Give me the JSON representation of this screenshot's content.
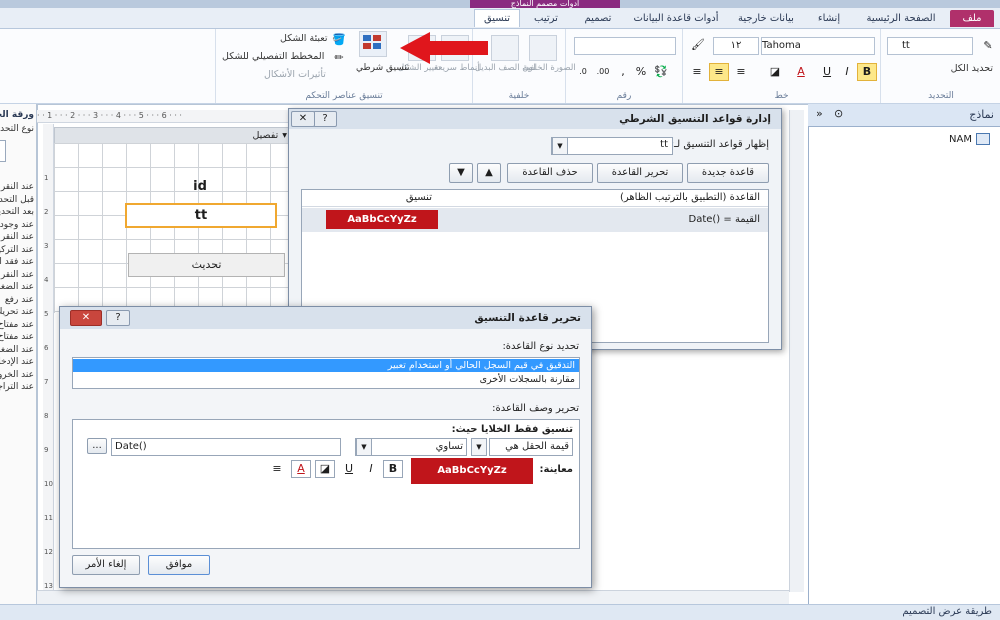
{
  "window": {
    "context_header": "أدوات مصمم النماذج"
  },
  "tabs": [
    {
      "label": "ملف",
      "kind": "file"
    },
    {
      "label": "الصفحة الرئيسية"
    },
    {
      "label": "إنشاء"
    },
    {
      "label": "بيانات خارجية"
    },
    {
      "label": "أدوات قاعدة البيانات"
    },
    {
      "label": "تصميم"
    },
    {
      "label": "ترتيب"
    },
    {
      "label": "تنسيق",
      "active": true
    }
  ],
  "ribbon": {
    "selection_group": {
      "label": "التحديد",
      "combo": "tt",
      "select_all": "تحديد الكل"
    },
    "font_group": {
      "label": "خط",
      "font_name": "Tahoma",
      "font_size": "١٢"
    },
    "number_group": {
      "label": "رقم"
    },
    "background_group": {
      "label": "خلفية",
      "image_label": "الصورة الخلفية",
      "alt_color_label": "لون الصف البديل"
    },
    "control_format_group": {
      "label": "تنسيق عناصر التحكم",
      "quick_styles": "أنماط سريعة",
      "change_shape": "تغيير الشكل",
      "conditional_formatting": "تنسيق شرطي",
      "shape_fill": "تعبئة الشكل",
      "shape_outline": "المخطط التفصيلي للشكل",
      "shape_effects": "تأثيرات الأشكال"
    }
  },
  "left_panel": {
    "title": "ورقة الخصائص",
    "subtitle": "نوع التحديد",
    "events": [
      "عند النقر",
      "قبل التحديث",
      "بعد التحديث",
      "عند وجود بيانات",
      "عند النقر",
      "عند التركيز",
      "عند فقد التركيز",
      "عند النقر",
      "عند الضغط",
      "عند رفع",
      "عند تحريك",
      "عند مفتاح",
      "عند مفتاح",
      "عند الضغط",
      "عند الإدخال",
      "عند الخروج",
      "عند التراجع"
    ]
  },
  "design": {
    "section_title": "تفصيل",
    "ruler_text": "· · 1 · · · 2 · · · 3 · · · 4 · · · 5 · · · 6 · · ·",
    "ruler_left_nums": [
      "1",
      "2",
      "3",
      "4",
      "5",
      "6",
      "7",
      "8",
      "9",
      "10",
      "11",
      "12",
      "13"
    ],
    "controls": {
      "id_label": "id",
      "tt_field": "tt",
      "refresh_button": "تحديث"
    }
  },
  "nav_pane": {
    "title": "نماذج",
    "item": "NAM"
  },
  "status_bar": {
    "text": "طريقة عرض التصميم"
  },
  "cf_manager": {
    "title": "إدارة قواعد التنسيق الشرطي",
    "show_rules_label": "إظهار قواعد التنسيق لـ:",
    "show_rules_value": "tt",
    "new_rule": "قاعدة جديدة",
    "edit_rule": "تحرير القاعدة",
    "delete_rule": "حذف القاعدة",
    "col_rule": "القاعدة (التطبيق بالترتيب الظاهر)",
    "col_format": "تنسيق",
    "rule_text": "القيمة = ()Date",
    "preview_text": "AaBbCcYyZz",
    "preview_color": "#c0151b"
  },
  "edit_rule": {
    "title": "تحرير قاعدة التنسيق",
    "select_type_label": "تحديد نوع القاعدة:",
    "rule_types": [
      "التدقيق في قيم السجل الحالي أو استخدام تعبير",
      "مقارنة بالسجلات الأخرى"
    ],
    "edit_desc_label": "تحرير وصف القاعدة:",
    "format_only_label": "تنسيق فقط الخلايا حيث:",
    "condition_field": "قيمة الحقل هي",
    "operator": "تساوي",
    "expression": "Date()",
    "expression_button": "...",
    "preview_label": "معاينة:",
    "preview_text": "AaBbCcYyZz",
    "preview_color": "#c0151b",
    "ok": "موافق",
    "cancel": "إلغاء الأمر",
    "bold": "B",
    "italic": "I",
    "underline": "U"
  },
  "colors": {
    "accent": "#b0306b",
    "highlight_selection": "#3399ff",
    "annotation_arrow": "#e0161c"
  }
}
